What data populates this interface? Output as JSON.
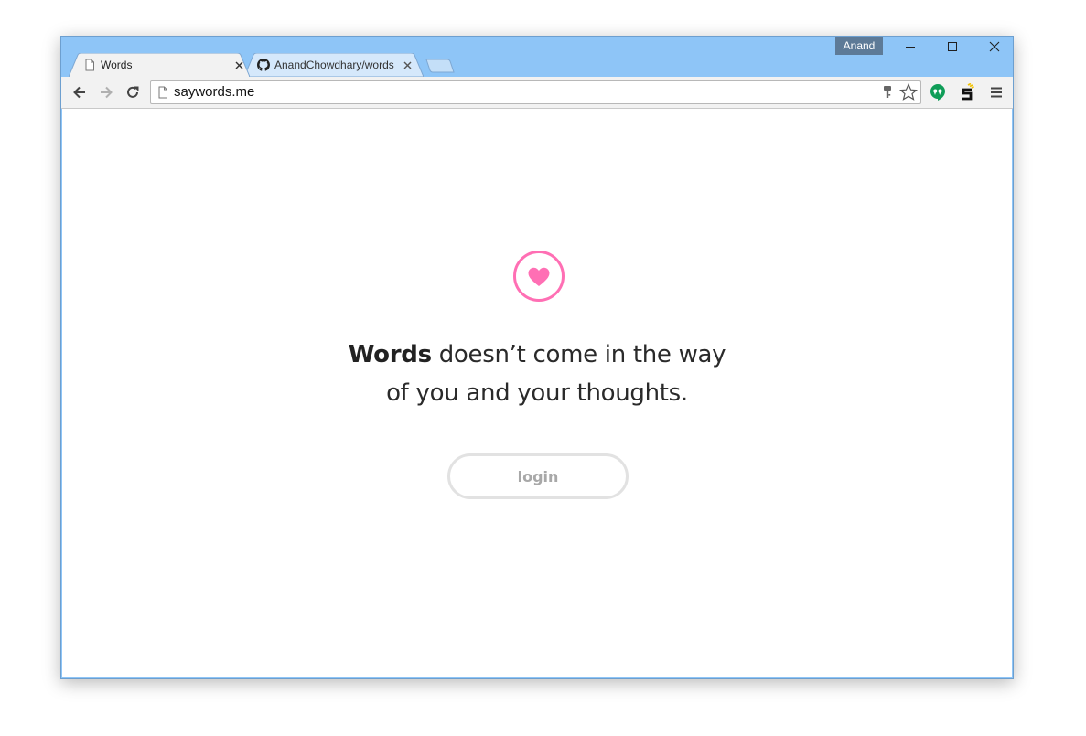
{
  "window": {
    "profile_name": "Anand",
    "controls": {
      "minimize": "minimize-icon",
      "maximize": "maximize-icon",
      "close": "close-icon"
    }
  },
  "tabs": [
    {
      "title": "Words",
      "icon": "page-icon",
      "active": true
    },
    {
      "title": "AnandChowdhary/words",
      "icon": "github-icon",
      "active": false
    }
  ],
  "toolbar": {
    "url": "saywords.me",
    "icons": [
      "back-icon",
      "forward-icon",
      "reload-icon",
      "page-icon",
      "key-icon",
      "star-icon",
      "hangouts-icon",
      "s-extension-icon",
      "menu-icon"
    ]
  },
  "page": {
    "logo_icon": "heart-icon",
    "tagline_brand": "Words",
    "tagline_line1_rest": " doesn’t come in the way",
    "tagline_line2": "of you and your thoughts.",
    "login_label": "login"
  },
  "colors": {
    "accent_pink": "#ff6fb4",
    "titlebar_blue": "#8ec5f7",
    "profile_badge": "#5d7a97",
    "login_border": "#e2e2e2",
    "login_text": "#a8a8a8"
  }
}
